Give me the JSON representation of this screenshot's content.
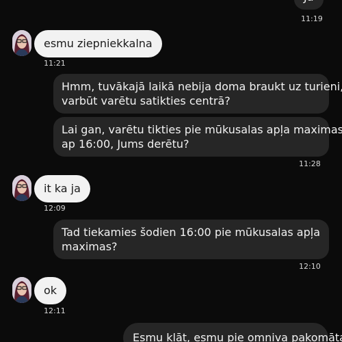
{
  "messages": [
    {
      "id": "m0",
      "direction": "outgoing",
      "text": "Jā",
      "time": "11:19"
    },
    {
      "id": "m1",
      "direction": "incoming",
      "text": "esmu ziepniekkalna",
      "time": "11:21"
    },
    {
      "id": "m2",
      "direction": "outgoing",
      "lines": [
        "Hmm, tuvākajā laikā nebija doma braukt uz turieni,",
        "varbūt varētu satikties centrā?"
      ]
    },
    {
      "id": "m3",
      "direction": "outgoing",
      "lines": [
        "Lai gan, varētu tikties pie mūkusalas apļa maximas,",
        "ap 16:00, Jums derētu?"
      ],
      "time": "11:28"
    },
    {
      "id": "m4",
      "direction": "incoming",
      "text": "it ka ja",
      "time": "12:09"
    },
    {
      "id": "m5",
      "direction": "outgoing",
      "lines": [
        "Tad tiekamies šodien 16:00 pie mūkusalas apļa",
        "maximas?"
      ],
      "time": "12:10"
    },
    {
      "id": "m6",
      "direction": "incoming",
      "text": "ok",
      "time": "12:11"
    },
    {
      "id": "m7",
      "direction": "outgoing",
      "text": "Esmu klāt, esmu pie omniva pakomāta."
    }
  ],
  "colors": {
    "background": "#0b0b0b",
    "incoming_bubble": "#f2f2f2",
    "outgoing_bubble": "#262626",
    "timestamp": "#d8d8d8"
  },
  "icons": {
    "contact_avatar": "contact-avatar"
  }
}
